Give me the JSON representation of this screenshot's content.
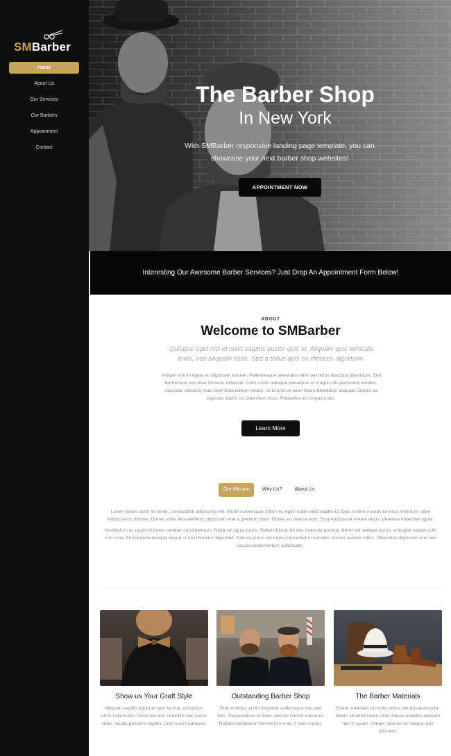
{
  "brand": {
    "prefix": "SM",
    "suffix": "Barber"
  },
  "nav": [
    {
      "label": "Home",
      "active": true
    },
    {
      "label": "About Us"
    },
    {
      "label": "Our Services"
    },
    {
      "label": "Our Barbers"
    },
    {
      "label": "Appointment"
    },
    {
      "label": "Contact"
    }
  ],
  "hero": {
    "title": "The Barber Shop",
    "subtitle": "In New York",
    "text": "With SMBarber responsive landing page template, you can showcase your next barber shop websites!",
    "button": "APPOINTMENT NOW"
  },
  "banner": {
    "text": "Interesting Our Awesome Barber Services? Just Drop An Appointment Form Below!"
  },
  "about": {
    "label": "ABOUT",
    "title": "Welcome to SMBarber",
    "lead": "Quisque eget nisi id nulla sagittis auctor quis id. Aliquam quis vehicula enim, non aliquam risus. Sed a tellus quis mi rhoncus dignissim.",
    "body": "Integer rutrum ligula eu dignissim laoreet. Pellentesque venenatis nibh sed tellus faucibus bibendum. Sed fermentum est vitae rhoncus molestie. Cum sociis natoque penatibus et magnis dis parturient montes, nascetur ridiculus mus. Sed vitae rutrum neque. Ut id erat sit amet libero bibendum aliquam. Donec ac egestas libero, eu bibendum risus. Phasellus et congue justo.",
    "button": "Learn More"
  },
  "tabs": [
    {
      "label": "Our Mission",
      "active": true
    },
    {
      "label": "Why Us?"
    },
    {
      "label": "About Us"
    }
  ],
  "tab_content": {
    "p1": "Lorem ipsum dolor sit amet, consectetur adipiscing elit. Morbi scelerisque tortor mi, eget mattis velit sagittis id. Duis ornare mauris eu eros interdum, vitae finibus arcu ultricies. Donec vitae felis eleifend, dignissim erat a, pretium diam. Donec eu massa odio. Suspendisse et ornare lacus, pharetra imperdiet ligula.",
    "p2": "Vestibulum ac quam id lorem semper condimentum. Nulla vel ligula turpis. Nullam luctus mi nec molestie gravida, tortor est semper purus, a feugiat sapien odio non urna. Fusce pellentesque neque ut nisi rhoncus imperdiet. Sed eu purus vel turpis consectetur convallis. Donec a dolor tellus. Phasellus dignissim erat nec ipsum condimentum sollicitudin."
  },
  "cards": [
    {
      "title": "Show us Your Graft Style",
      "text": "Aliquam sagittis ligula et sem lacinia, ut facilisis enim sollicitudin. Proin nisi est, convallis nec purus vitae, iaculis posuere sapien. Cum sociis natoque."
    },
    {
      "title": "Outstanding Barber Shop",
      "text": "Duis et tellus at dui tincidunt scelerisque nec sed felis. Suspendisse id dolor sed leo rutrum euismod. Nullam vestibulum fermentum erat. It nam auctor."
    },
    {
      "title": "The Barber Materials",
      "text": "Etiam materials ut mollis tellus, vel posuere nulla. Etiam sit amet lacus vitae massa sodales aliquam nec in quam. Integer ultricies et magna quis posuere."
    }
  ],
  "colors": {
    "accent": "#c7a45c",
    "dark": "#0f0f0f"
  }
}
